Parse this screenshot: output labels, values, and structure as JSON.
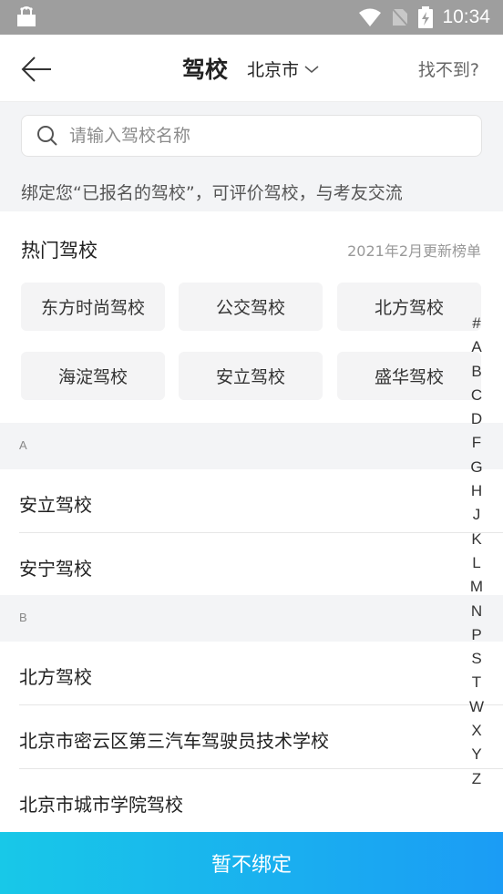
{
  "status_bar": {
    "time": "10:34"
  },
  "nav": {
    "title": "驾校",
    "city": "北京市",
    "not_found": "找不到?"
  },
  "search": {
    "placeholder": "请输入驾校名称"
  },
  "tip": "绑定您“已报名的驾校”，可评价驾校，与考友交流",
  "hot": {
    "title": "热门驾校",
    "update": "2021年2月更新榜单",
    "items": [
      "东方时尚驾校",
      "公交驾校",
      "北方驾校",
      "海淀驾校",
      "安立驾校",
      "盛华驾校"
    ]
  },
  "groups": [
    {
      "letter": "A",
      "items": [
        "安立驾校",
        "安宁驾校"
      ]
    },
    {
      "letter": "B",
      "items": [
        "北方驾校",
        "北京市密云区第三汽车驾驶员技术学校",
        "北京市城市学院驾校"
      ]
    }
  ],
  "index_letters": [
    "#",
    "A",
    "B",
    "C",
    "D",
    "F",
    "G",
    "H",
    "J",
    "K",
    "L",
    "M",
    "N",
    "P",
    "S",
    "T",
    "W",
    "X",
    "Y",
    "Z"
  ],
  "bottom_button": "暂不绑定",
  "colors": {
    "accent_start": "#18c8e8",
    "accent_end": "#1b9cf5",
    "status_bar": "#9e9e9e"
  }
}
